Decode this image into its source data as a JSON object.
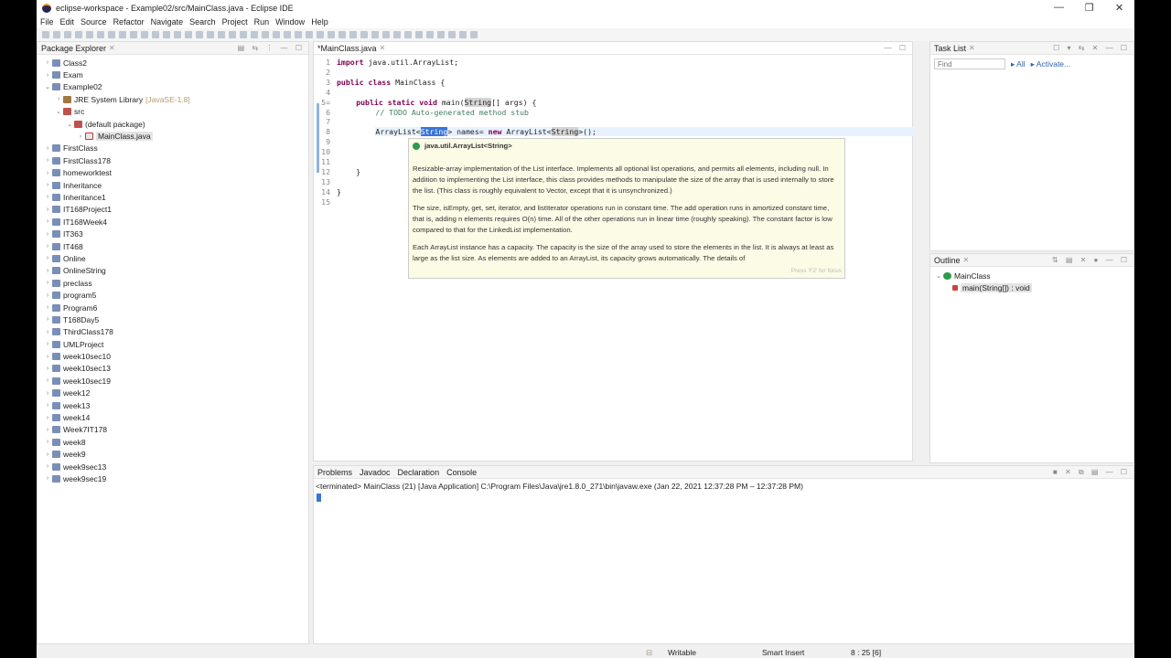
{
  "window": {
    "title": "eclipse-workspace - Example02/src/MainClass.java - Eclipse IDE",
    "min": "—",
    "max": "❐",
    "close": "✕"
  },
  "menu": [
    "File",
    "Edit",
    "Source",
    "Refactor",
    "Navigate",
    "Search",
    "Project",
    "Run",
    "Window",
    "Help"
  ],
  "package_explorer": {
    "title": "Package Explorer",
    "items": [
      {
        "label": "Class2",
        "depth": 0,
        "arrow": "›",
        "icon": "project"
      },
      {
        "label": "Exam",
        "depth": 0,
        "arrow": "›",
        "icon": "project"
      },
      {
        "label": "Example02",
        "depth": 0,
        "arrow": "⌄",
        "icon": "project"
      },
      {
        "label": "JRE System Library",
        "extra": "[JavaSE-1.8]",
        "depth": 1,
        "arrow": "›",
        "icon": "library"
      },
      {
        "label": "src",
        "depth": 1,
        "arrow": "⌄",
        "icon": "package"
      },
      {
        "label": "(default package)",
        "depth": 2,
        "arrow": "⌄",
        "icon": "package"
      },
      {
        "label": "MainClass.java",
        "depth": 3,
        "arrow": "›",
        "icon": "file",
        "selected": true
      },
      {
        "label": "FirstClass",
        "depth": 0,
        "arrow": "›",
        "icon": "project"
      },
      {
        "label": "FirstClass178",
        "depth": 0,
        "arrow": "›",
        "icon": "project"
      },
      {
        "label": "homeworktest",
        "depth": 0,
        "arrow": "›",
        "icon": "project"
      },
      {
        "label": "Inheritance",
        "depth": 0,
        "arrow": "›",
        "icon": "project"
      },
      {
        "label": "Inheritance1",
        "depth": 0,
        "arrow": "›",
        "icon": "project"
      },
      {
        "label": "IT168Project1",
        "depth": 0,
        "arrow": "›",
        "icon": "project"
      },
      {
        "label": "IT168Week4",
        "depth": 0,
        "arrow": "›",
        "icon": "project"
      },
      {
        "label": "IT363",
        "depth": 0,
        "arrow": "›",
        "icon": "project"
      },
      {
        "label": "IT468",
        "depth": 0,
        "arrow": "›",
        "icon": "project"
      },
      {
        "label": "Online",
        "depth": 0,
        "arrow": "›",
        "icon": "project"
      },
      {
        "label": "OnlineString",
        "depth": 0,
        "arrow": "›",
        "icon": "project"
      },
      {
        "label": "preclass",
        "depth": 0,
        "arrow": "›",
        "icon": "project"
      },
      {
        "label": "program5",
        "depth": 0,
        "arrow": "›",
        "icon": "project"
      },
      {
        "label": "Program6",
        "depth": 0,
        "arrow": "›",
        "icon": "project"
      },
      {
        "label": "T168Day5",
        "depth": 0,
        "arrow": "›",
        "icon": "project"
      },
      {
        "label": "ThirdClass178",
        "depth": 0,
        "arrow": "›",
        "icon": "project"
      },
      {
        "label": "UMLProject",
        "depth": 0,
        "arrow": "›",
        "icon": "project"
      },
      {
        "label": "week10sec10",
        "depth": 0,
        "arrow": "›",
        "icon": "project"
      },
      {
        "label": "week10sec13",
        "depth": 0,
        "arrow": "›",
        "icon": "project"
      },
      {
        "label": "week10sec19",
        "depth": 0,
        "arrow": "›",
        "icon": "project"
      },
      {
        "label": "week12",
        "depth": 0,
        "arrow": "›",
        "icon": "project"
      },
      {
        "label": "week13",
        "depth": 0,
        "arrow": "›",
        "icon": "project"
      },
      {
        "label": "week14",
        "depth": 0,
        "arrow": "›",
        "icon": "project"
      },
      {
        "label": "Week7IT178",
        "depth": 0,
        "arrow": "›",
        "icon": "project"
      },
      {
        "label": "week8",
        "depth": 0,
        "arrow": "›",
        "icon": "project"
      },
      {
        "label": "week9",
        "depth": 0,
        "arrow": "›",
        "icon": "project"
      },
      {
        "label": "week9sec13",
        "depth": 0,
        "arrow": "›",
        "icon": "project"
      },
      {
        "label": "week9sec19",
        "depth": 0,
        "arrow": "›",
        "icon": "project"
      }
    ]
  },
  "editor": {
    "tab": "*MainClass.java",
    "line_numbers": [
      "1",
      "2",
      "3",
      "4",
      "5=",
      "6",
      "7",
      "8",
      "9",
      "10",
      "11",
      "12",
      "13",
      "14",
      "15"
    ],
    "l1": {
      "kw": "import",
      "rest": " java.util.ArrayList;"
    },
    "l3": {
      "kw1": "public",
      "kw2": "class",
      "rest": " MainClass {"
    },
    "l5": {
      "kws": "public static void",
      "a": " main(",
      "type": "String",
      "b": "[] args) {"
    },
    "l6": "// TODO Auto-generated method stub",
    "l8": {
      "a": "ArrayList<",
      "sel": "String",
      "b": "> names= ",
      "kw": "new",
      "c": " ArrayList<",
      "type": "String",
      "d": ">();"
    },
    "l12": "}",
    "l14": "}"
  },
  "hover": {
    "header": "java.util.ArrayList<String>",
    "p1": "Resizable-array implementation of the List interface. Implements all optional list operations, and permits all elements, including null. In addition to implementing the List interface, this class provides methods to manipulate the size of the array that is used internally to store the list. (This class is roughly equivalent to Vector, except that it is unsynchronized.)",
    "p2": "The size, isEmpty, get, set, iterator, and listIterator operations run in constant time. The add operation runs in amortized constant time, that is, adding n elements requires O(n) time. All of the other operations run in linear time (roughly speaking). The constant factor is low compared to that for the LinkedList implementation.",
    "p3": "Each ArrayList instance has a capacity. The capacity is the size of the array used to store the elements in the list. It is always at least as large as the list size. As elements are added to an ArrayList, its capacity grows automatically. The details of",
    "footer": "Press 'F2' for focus"
  },
  "task_list": {
    "title": "Task List",
    "find_placeholder": "Find",
    "all": "All",
    "activate": "Activate..."
  },
  "outline": {
    "title": "Outline",
    "class": "MainClass",
    "method": "main(String[]) : void"
  },
  "bottom": {
    "tabs": [
      "Problems",
      "Javadoc",
      "Declaration",
      "Console"
    ],
    "console_header": "<terminated> MainClass (21) [Java Application] C:\\Program Files\\Java\\jre1.8.0_271\\bin\\javaw.exe  (Jan 22, 2021 12:37:28 PM – 12:37:28 PM)"
  },
  "status": {
    "writable": "Writable",
    "insert": "Smart Insert",
    "position": "8 : 25 [6]"
  }
}
